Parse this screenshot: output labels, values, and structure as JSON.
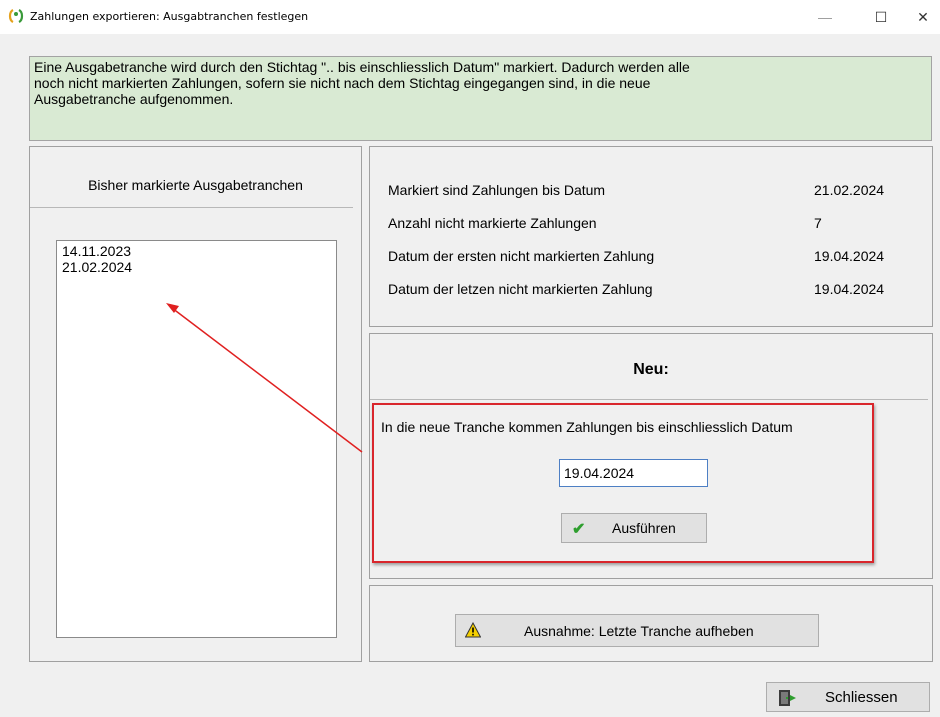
{
  "window": {
    "title": "Zahlungen exportieren: Ausgabtranchen festlegen",
    "minimize": "—",
    "maximize": "☐",
    "close": "✕"
  },
  "info": {
    "text_line1": "Eine Ausgabetranche wird durch den Stichtag \".. bis einschliesslich Datum\" markiert. Dadurch werden alle",
    "text_line2": "noch nicht markierten Zahlungen, sofern sie nicht nach dem Stichtag eingegangen sind,  in die neue",
    "text_line3": "Ausgabetranche aufgenommen."
  },
  "left_panel": {
    "header": "Bisher markierte Ausgabetranchen",
    "items": [
      "14.11.2023",
      "21.02.2024"
    ]
  },
  "stats": [
    {
      "label": "Markiert sind  Zahlungen bis Datum",
      "value": "21.02.2024"
    },
    {
      "label": "Anzahl nicht markierte Zahlungen",
      "value": "7"
    },
    {
      "label": "Datum der ersten nicht markierten Zahlung",
      "value": "19.04.2024"
    },
    {
      "label": "Datum der letzen nicht markierten Zahlung",
      "value": "19.04.2024"
    }
  ],
  "new_tranche": {
    "title": "Neu:",
    "description": "In die neue Tranche kommen Zahlungen  bis einschliesslich Datum",
    "date_value": "19.04.2024",
    "run_button": "Ausführen"
  },
  "exception_button": "Ausnahme: Letzte Tranche aufheben",
  "close_button": "Schliessen",
  "colors": {
    "info_bg": "#d9ead3",
    "highlight": "#d9262c",
    "check": "#2e9e2e",
    "warning": "#f5d000"
  }
}
